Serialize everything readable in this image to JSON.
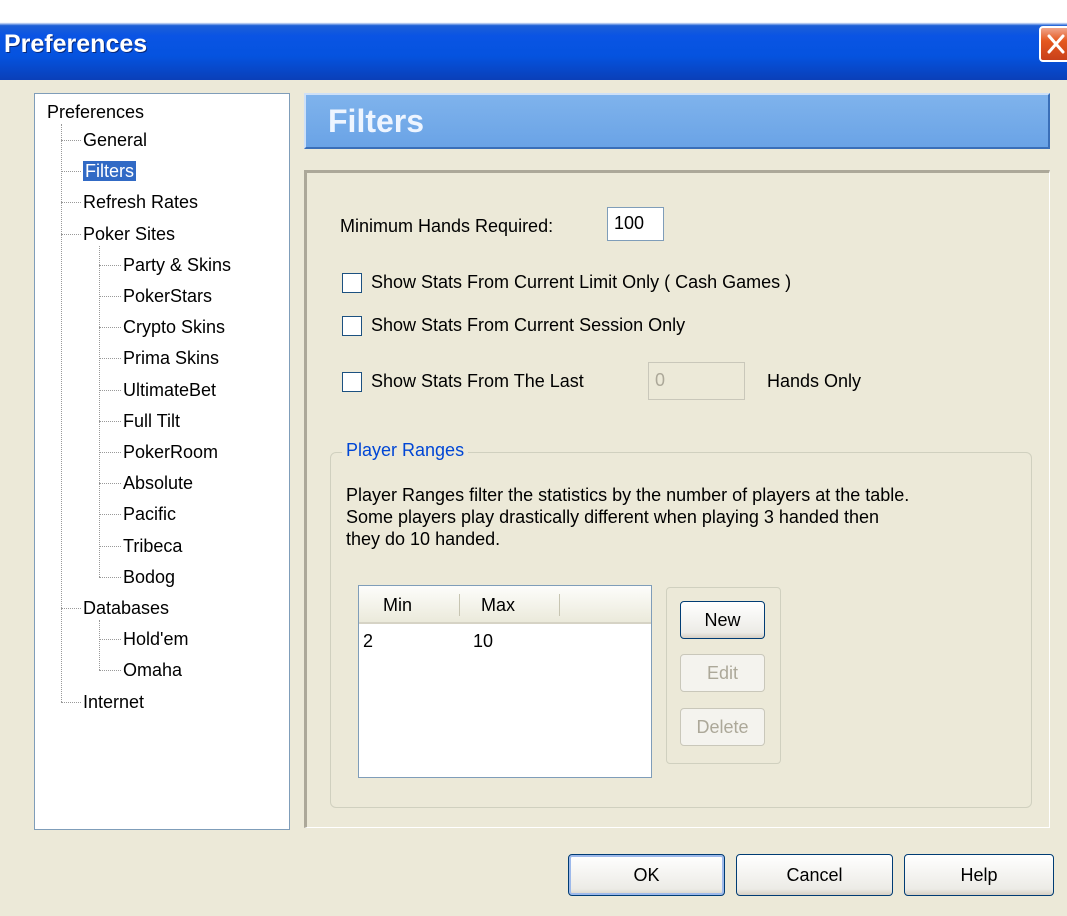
{
  "window": {
    "title": "Preferences"
  },
  "tree": {
    "root": "Preferences",
    "items": [
      {
        "label": "General",
        "level": 1
      },
      {
        "label": "Filters",
        "level": 1,
        "selected": true
      },
      {
        "label": "Refresh Rates",
        "level": 1
      },
      {
        "label": "Poker Sites",
        "level": 1
      },
      {
        "label": "Party & Skins",
        "level": 2
      },
      {
        "label": "PokerStars",
        "level": 2
      },
      {
        "label": "Crypto Skins",
        "level": 2
      },
      {
        "label": "Prima Skins",
        "level": 2
      },
      {
        "label": "UltimateBet",
        "level": 2
      },
      {
        "label": "Full Tilt",
        "level": 2
      },
      {
        "label": "PokerRoom",
        "level": 2
      },
      {
        "label": "Absolute",
        "level": 2
      },
      {
        "label": "Pacific",
        "level": 2
      },
      {
        "label": "Tribeca",
        "level": 2
      },
      {
        "label": "Bodog",
        "level": 2
      },
      {
        "label": "Databases",
        "level": 1
      },
      {
        "label": "Hold'em",
        "level": 2
      },
      {
        "label": "Omaha",
        "level": 2
      },
      {
        "label": "Internet",
        "level": 1
      }
    ]
  },
  "panel": {
    "title": "Filters",
    "min_hands_label": "Minimum Hands Required:",
    "min_hands_value": "100",
    "checkbox_limit": "Show Stats From Current Limit Only  ( Cash Games )",
    "checkbox_session": "Show Stats From Current Session Only",
    "checkbox_last": "Show Stats From The Last",
    "last_hands_value": "0",
    "hands_only": "Hands Only",
    "group_title": "Player Ranges",
    "desc_line1": "Player Ranges filter the statistics by the number of players at the table.",
    "desc_line2": "Some players play drastically different when playing 3 handed then",
    "desc_line3": "they do 10 handed.",
    "columns": [
      "Min",
      "Max"
    ],
    "rows": [
      {
        "min": "2",
        "max": "10"
      }
    ],
    "new_label": "New",
    "edit_label": "Edit",
    "delete_label": "Delete"
  },
  "footer": {
    "ok_label": "OK",
    "cancel_label": "Cancel",
    "help_label": "Help"
  }
}
